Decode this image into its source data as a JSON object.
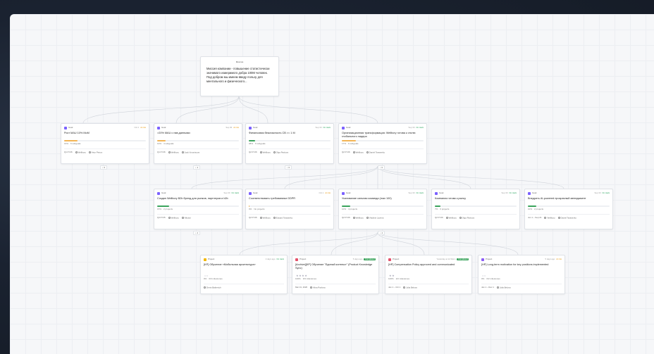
{
  "mission": {
    "label": "Миссия",
    "text": "Миссия компании - повышение статистически значимого измеримого добра 100М человек. Под добром мы имеем ввиду пользу для ментального и физического..."
  },
  "goals_level1": [
    {
      "type": "Goal",
      "date": "Oct 1",
      "status": "At risk",
      "status_kind": "risk",
      "title": "Рост MAU 10% MoM",
      "progress": 0.16,
      "progress_text": "16%",
      "subgoals": "6 subgoals",
      "period": "Q1 FY26",
      "org": "Wellbory",
      "owner": "Artur Petrov",
      "expand": "6",
      "fill": "orange"
    },
    {
      "type": "Goal",
      "date": "Sep 30",
      "status": "At risk",
      "status_kind": "risk",
      "title": ">20% MAU с нав.данными",
      "progress": 0.1,
      "progress_text": "10%",
      "subgoals": "4 subgoals",
      "period": "Q1 FY26",
      "org": "Wellbory",
      "owner": "Jack Vorontsova",
      "expand": "4",
      "fill": "orange"
    },
    {
      "type": "Goal",
      "date": "Sep 30",
      "status": "On track",
      "status_kind": "ok",
      "title": "Финансовая безопасность CB >= 1 М",
      "progress": 0.08,
      "progress_text": "08%",
      "subgoals": "6 subgoals",
      "period": "Q2 FY26",
      "org": "Wellbory",
      "owner": "Olga Pavlova",
      "expand": "6",
      "fill": "green"
    },
    {
      "type": "Goal",
      "date": "Sep 30",
      "status": "On track",
      "status_kind": "ok",
      "title": "Организационная трансформация: Wellbory готова к стилю глобального лидера",
      "progress": 0.17,
      "progress_text": "17%",
      "subgoals": "6 subgoals",
      "period": "Q2 FY26",
      "org": "Wellbory",
      "owner": "Daniel Tarasenko",
      "expand": "6",
      "fill": "orange"
    }
  ],
  "goals_level2": [
    {
      "type": "Goal",
      "date": "Sep 30",
      "status": "On track",
      "status_kind": "ok",
      "title": "Создан Wellbory B2b бренд для рынков, партнеров и b2b",
      "progress": 0.15,
      "progress_text": "15%",
      "subgoals": "2 projects",
      "period": "Q4 FY25",
      "org": "Wellbory",
      "owner": "Nikolai",
      "expand": "2",
      "fill": "green"
    },
    {
      "type": "Goal",
      "date": "Oct 1",
      "status": "At risk",
      "status_kind": "risk",
      "title": "Соответствовать требованиям GDPR",
      "progress": 0.0,
      "progress_text": "0%",
      "subgoals": "No projects",
      "period": "Q2 FY26",
      "org": "Wellbory",
      "owner": "Eduard Tarasenko",
      "expand": "",
      "fill": "orange"
    },
    {
      "type": "Goal",
      "date": "Sep 30",
      "status": "On track",
      "status_kind": "ok",
      "title": "Усиливание сильная команда (max 100)",
      "progress": 0.1,
      "progress_text": "10%",
      "subgoals": "4 projects",
      "period": "Q2 FY26",
      "org": "Wellbory",
      "owner": "Vladimir Lazeva",
      "expand": "4",
      "fill": "green"
    },
    {
      "type": "Goal",
      "date": "Sep 30",
      "status": "On track",
      "status_kind": "ok",
      "title": "Компания готова к рынку",
      "progress": 0.07,
      "progress_text": "7%",
      "subgoals": "6 projects",
      "period": "Q2 FY26",
      "org": "Wellbory",
      "owner": "Olga Pavlova",
      "expand": "",
      "fill": "green"
    },
    {
      "type": "Goal",
      "date": "Sep 30",
      "status": "On track",
      "status_kind": "ok",
      "title": "Внедрить AI-powered прозрачный менеджмент",
      "progress": 0.1,
      "progress_text": "10%",
      "subgoals": "2 projects",
      "period": "Jun 1 – Sep 21",
      "org": "Wellbory",
      "owner": "Daniel Tarasenko",
      "expand": "",
      "fill": "green"
    }
  ],
  "projects": [
    {
      "type": "Project",
      "ago": "2 days ago",
      "status": "On track",
      "status_kind": "ok",
      "title": "[KP] Обучение «Мобильная архитектура»",
      "stars": "○○",
      "progress_text": "0%",
      "milestones": "0/3 milestones",
      "owner": "Denis Batkevich",
      "period": "",
      "icon": "project-yellow"
    },
    {
      "type": "Project",
      "ago": "5 days ago",
      "status": "Completed",
      "status_kind": "done",
      "title": "[Archive][KP] Обучение \"Единый контекст\" (Product Knowledge Sync)",
      "stars": "★★★★",
      "progress_text": "100%",
      "milestones": "3/3 milestones",
      "owner": "Alina Pavlova",
      "period": "Mar 31, 2026",
      "icon": "project-red"
    },
    {
      "type": "Project",
      "ago": "Yesterday at 12:34pm",
      "status": "Completed",
      "status_kind": "done",
      "title": "[HP] Compensation Policy approved and communicated",
      "stars": "★★",
      "progress_text": "100%",
      "milestones": "2/2 milestones",
      "owner": "Julia Belova",
      "period": "Jan 1 – Oct 1",
      "icon": "project-red"
    },
    {
      "type": "Project",
      "ago": "5 days ago",
      "status": "At risk",
      "status_kind": "risk",
      "title": "[HP] Long-term motivation for key positions implemented",
      "stars": "○○",
      "progress_text": "0%",
      "milestones": "0/2 milestones",
      "owner": "Julia Belova",
      "period": "Jan 1 – Dec 1",
      "icon": "project-purple"
    }
  ],
  "colors": {
    "accent": "#7b61ff",
    "ok": "#25a35a",
    "risk": "#e89a12",
    "done": "#3aa35c",
    "edge": "#cfd3da"
  }
}
